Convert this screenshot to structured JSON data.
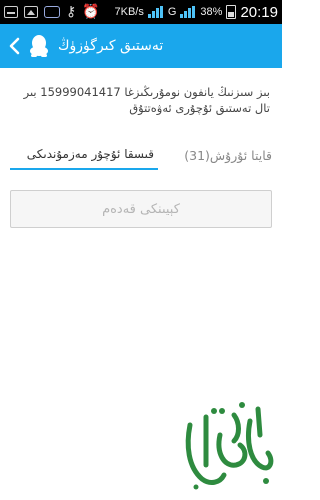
{
  "status_bar": {
    "speed": "7KB/s",
    "network_label": "G",
    "battery": "38%",
    "time": "20:19"
  },
  "header": {
    "title": "تەستىق كىرگۈزۈڭ"
  },
  "description": "بىز سىزنىڭ يانفون نومۇرىڭىزغا 15999041417 بىر تال تەستىق ئۇچۇرى ئەۋەتتۇق",
  "form": {
    "code_placeholder": "قىسقا ئۇچۇر مەزمۇندىكى",
    "resend_label": "قايتا ئۇرۇش(31)",
    "next_label": "كېيىنكى قەدەم"
  },
  "colors": {
    "accent": "#1aa7ec",
    "watermark": "#2e8b3f"
  }
}
